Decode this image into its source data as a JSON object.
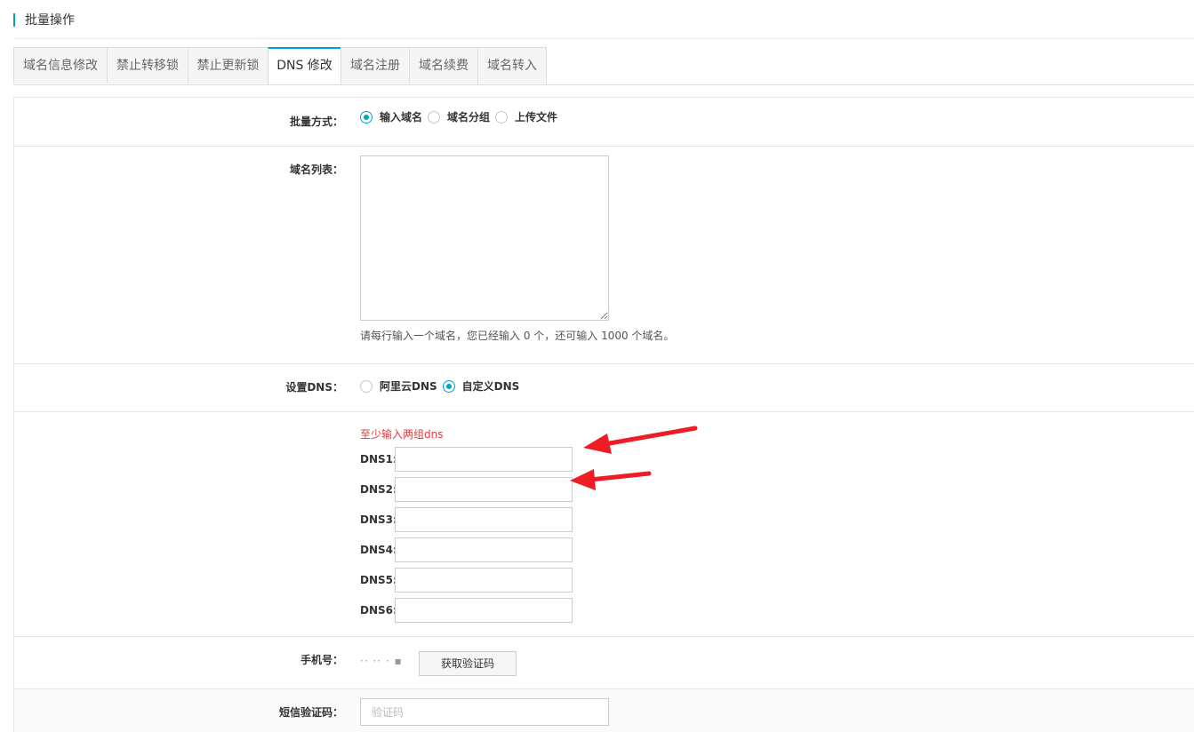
{
  "header": {
    "title": "批量操作"
  },
  "tabs": [
    {
      "label": "域名信息修改",
      "active": false
    },
    {
      "label": "禁止转移锁",
      "active": false
    },
    {
      "label": "禁止更新锁",
      "active": false
    },
    {
      "label": "DNS 修改",
      "active": true
    },
    {
      "label": "域名注册",
      "active": false
    },
    {
      "label": "域名续费",
      "active": false
    },
    {
      "label": "域名转入",
      "active": false
    }
  ],
  "form": {
    "batch_mode": {
      "label": "批量方式：",
      "options": [
        {
          "label": "输入域名",
          "checked": true
        },
        {
          "label": "域名分组",
          "checked": false
        },
        {
          "label": "上传文件",
          "checked": false
        }
      ]
    },
    "domain_list": {
      "label": "域名列表：",
      "value": "",
      "hint": "请每行输入一个域名，您已经输入 0 个，还可输入 1000 个域名。"
    },
    "dns_setting": {
      "label": "设置DNS：",
      "options": [
        {
          "label": "阿里云DNS",
          "checked": false
        },
        {
          "label": "自定义DNS",
          "checked": true
        }
      ]
    },
    "custom_dns": {
      "error": "至少输入两组dns",
      "fields": [
        {
          "label": "DNS1:",
          "value": ""
        },
        {
          "label": "DNS2:",
          "value": ""
        },
        {
          "label": "DNS3:",
          "value": ""
        },
        {
          "label": "DNS4:",
          "value": ""
        },
        {
          "label": "DNS5:",
          "value": ""
        },
        {
          "label": "DNS6:",
          "value": ""
        }
      ]
    },
    "phone": {
      "label": "手机号：",
      "value": "·· ·· ·  ▪",
      "get_code_button": "获取验证码"
    },
    "sms_code": {
      "label": "短信验证码：",
      "placeholder": "验证码",
      "value": ""
    }
  },
  "colors": {
    "accent": "#00a2ca",
    "error": "#e4393c",
    "annotation_arrow": "#ee1c24"
  }
}
